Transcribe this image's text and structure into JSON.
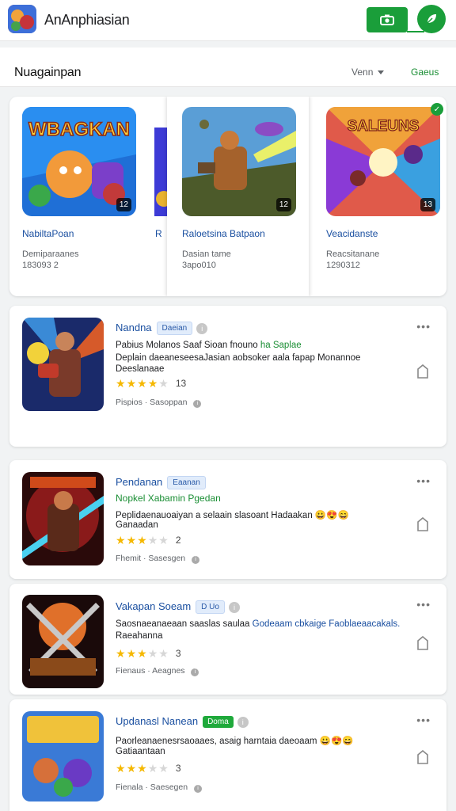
{
  "header": {
    "title": "AnAnphiasian"
  },
  "subheader": {
    "title": "Nuagainpan",
    "sort_label": "Venn",
    "link_label": "Gaeus"
  },
  "featured": [
    {
      "name": "NabiltaPoan",
      "age": "12",
      "meta1": "Demiparaanes",
      "meta2": "183093 2",
      "art_text": "WBAGKAN"
    },
    {
      "name": "Raloetsina Batpaon",
      "age": "12",
      "meta1": "Dasian tame",
      "meta2": "3apo010",
      "cut_letter": "R"
    },
    {
      "name": "Veacidanste",
      "age": "13",
      "meta1": "Reacsitanane",
      "meta2": "1290312",
      "art_text": "SALEUNS"
    }
  ],
  "list": [
    {
      "title": "Nandna",
      "tag": "Daeian",
      "line1": "Pabius Molanos Saaf Sioan fnouno",
      "line1_hl": "ha Saplae",
      "line2": "Deplain daeaneseesaJasian aobsoker aala fapap Monannoe",
      "line3": "Deeslanaae",
      "rating": 4,
      "rating_text": "13",
      "footer": "Pispios · Sasoppan"
    },
    {
      "title": "Pendanan",
      "tag": "Eaanan",
      "subtitle": "Nopkel Xabamin Pgedan",
      "line2": "Peplidaenauoaiyan a selaain slasoant Hadaakan 😀😍😄",
      "line3": "Ganaadan",
      "rating": 3,
      "rating_text": "2",
      "footer": "Fhemit · Sasesgen"
    },
    {
      "title": "Vakapan Soeam",
      "tag": "D Uo",
      "line2_a": "Saosnaeanaeaan saaslas saulaa",
      "line2_b": "Godeaam cbkaige",
      "line2_c": "Faoblaeaacakals.",
      "line3": "Raeahanna",
      "rating": 3,
      "rating_text": "3",
      "footer": "Fienaus · Aeagnes"
    },
    {
      "title": "Updanasl Nanean",
      "tag": "Doma",
      "line2": "Paorleanaenesrsaoaaes, asaig harntaia daeoaam 😀😍😄",
      "line3": "Gatiaantaan",
      "rating": 3,
      "rating_text": "3",
      "footer": "Fienala · Saesegen"
    }
  ],
  "theme": {
    "accent": "#1a9e3a",
    "link": "#1a4fa0",
    "star": "#f5b800"
  }
}
